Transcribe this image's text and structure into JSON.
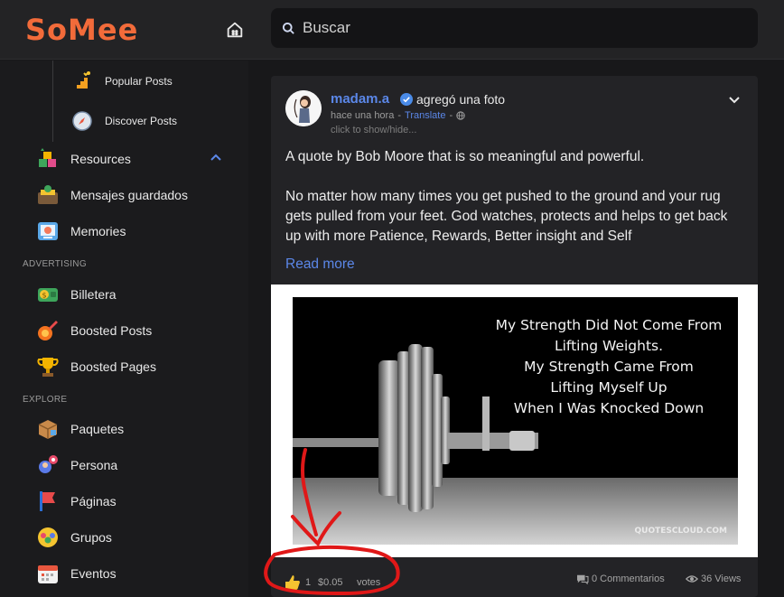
{
  "app": {
    "logo_text": "SoMee",
    "brand_color": "#f26b3a",
    "accent_color": "#5b87e8"
  },
  "header": {
    "search_placeholder": "Buscar",
    "home_icon": "home-icon"
  },
  "sidebar": {
    "sub_items": [
      {
        "label": "Popular Posts",
        "icon": "popular-posts-icon"
      },
      {
        "label": "Discover Posts",
        "icon": "compass-icon"
      }
    ],
    "items_top": [
      {
        "label": "Resources",
        "icon": "resources-icon"
      },
      {
        "label": "Mensajes guardados",
        "icon": "saved-messages-icon"
      },
      {
        "label": "Memories",
        "icon": "memories-icon"
      }
    ],
    "section_advertising": "ADVERTISING",
    "items_advertising": [
      {
        "label": "Billetera",
        "icon": "wallet-icon"
      },
      {
        "label": "Boosted Posts",
        "icon": "rocket-icon"
      },
      {
        "label": "Boosted Pages",
        "icon": "trophy-icon"
      }
    ],
    "section_explore": "EXPLORE",
    "items_explore": [
      {
        "label": "Paquetes",
        "icon": "package-icon"
      },
      {
        "label": "Persona",
        "icon": "persona-icon"
      },
      {
        "label": "Páginas",
        "icon": "flag-icon"
      },
      {
        "label": "Grupos",
        "icon": "groups-icon"
      },
      {
        "label": "Eventos",
        "icon": "calendar-icon"
      }
    ]
  },
  "post": {
    "author": "madam.a",
    "action": "agregó una foto",
    "time": "hace una hora",
    "translate": "Translate",
    "show_hide": "click to show/hide...",
    "paragraph1": "A quote by Bob Moore that is so meaningful and powerful.",
    "paragraph2": "No matter how many times you get pushed to the ground and your rug gets pulled from your feet. God watches, protects and helps to get back up with more Patience, Rewards, Better insight and Self",
    "read_more": "Read more",
    "image_quote_lines": [
      "My Strength Did Not Come From",
      "Lifting Weights.",
      "My Strength Came From",
      "Lifting Myself Up",
      "When I Was Knocked Down"
    ],
    "image_watermark": "QUOTESCLOUD.COM",
    "likes": "1",
    "amount": "$0.05",
    "votes_label": "votes",
    "comments": "0 Commentarios",
    "views": "36 Views"
  }
}
